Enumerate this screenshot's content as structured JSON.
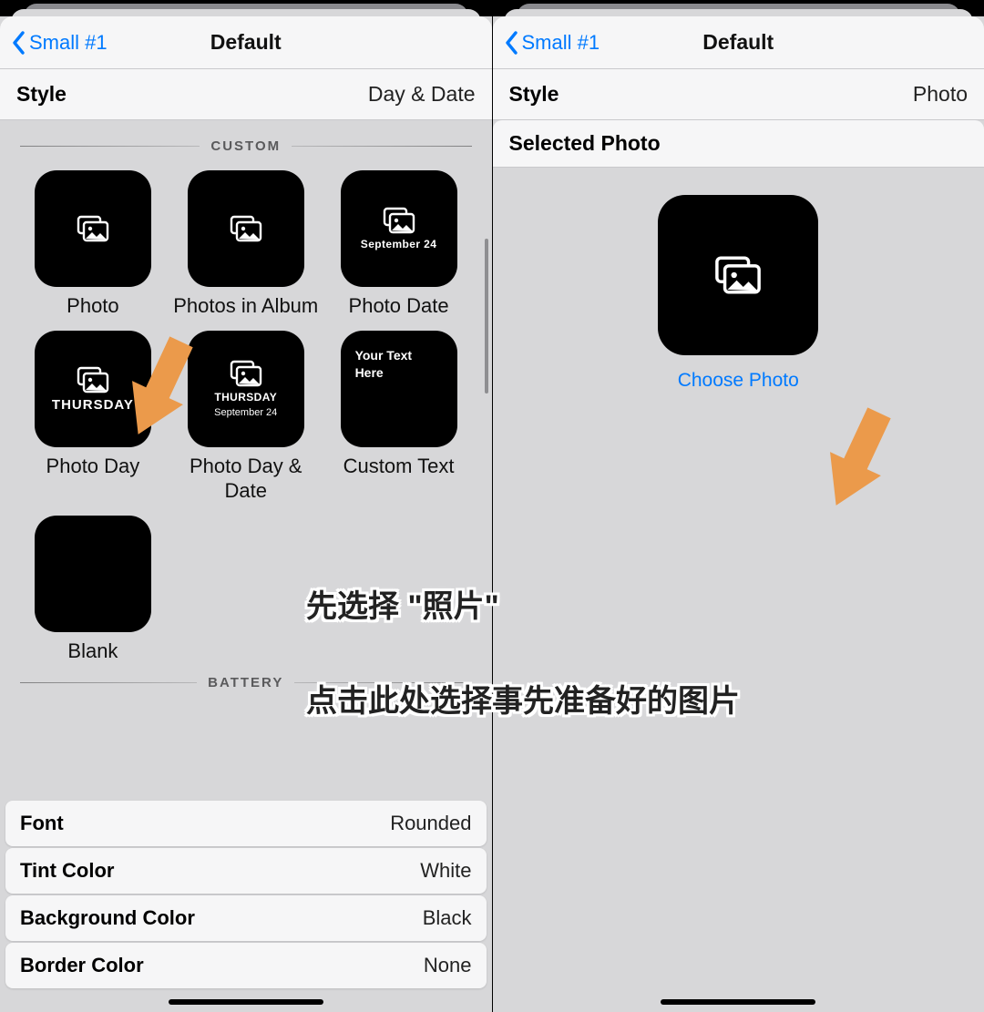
{
  "left": {
    "nav": {
      "back": "Small #1",
      "title": "Default"
    },
    "style_row": {
      "label": "Style",
      "value": "Day & Date"
    },
    "group_custom": "CUSTOM",
    "group_battery": "BATTERY",
    "tiles": [
      {
        "label": "Photo",
        "line1": "",
        "line2": ""
      },
      {
        "label": "Photos in Album",
        "line1": "",
        "line2": ""
      },
      {
        "label": "Photo Date",
        "line1": "",
        "line2": "September 24"
      },
      {
        "label": "Photo Day",
        "line1": "",
        "line2": "THURSDAY"
      },
      {
        "label": "Photo Day & Date",
        "line1": "THURSDAY",
        "line2": "September 24"
      },
      {
        "label": "Custom Text",
        "custom": "Your Text\nHere"
      },
      {
        "label": "Blank",
        "blank": true
      }
    ],
    "options": [
      {
        "k": "Font",
        "v": "Rounded"
      },
      {
        "k": "Tint Color",
        "v": "White"
      },
      {
        "k": "Background Color",
        "v": "Black"
      },
      {
        "k": "Border Color",
        "v": "None"
      }
    ]
  },
  "right": {
    "nav": {
      "back": "Small #1",
      "title": "Default"
    },
    "style_row": {
      "label": "Style",
      "value": "Photo"
    },
    "section": "Selected Photo",
    "choose": "Choose Photo"
  },
  "annotations": {
    "line1": "先选择 \"照片\"",
    "line2": "点击此处选择事先准备好的图片"
  },
  "colors": {
    "accent": "#007aff",
    "arrow": "#eb9a4b"
  }
}
